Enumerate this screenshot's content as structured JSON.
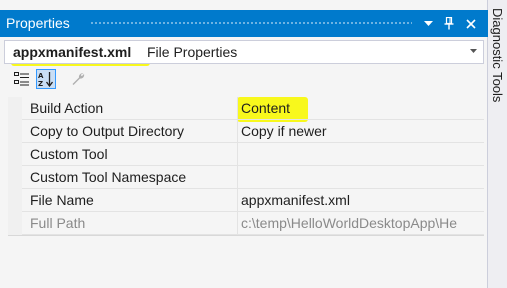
{
  "window": {
    "title": "Properties",
    "buttons": {
      "dropdown_icon": "chevron-down-icon",
      "pin_icon": "pin-icon",
      "close_icon": "close-icon"
    }
  },
  "object_selector": {
    "name": "appxmanifest.xml",
    "type": "File Properties"
  },
  "toolbar": {
    "categorized_icon": "categorized-icon",
    "alphabetical_icon": "alphabetical-icon",
    "property_pages_icon": "wrench-icon"
  },
  "properties": [
    {
      "name": "Build Action",
      "value": "Content"
    },
    {
      "name": "Copy to Output Directory",
      "value": "Copy if newer"
    },
    {
      "name": "Custom Tool",
      "value": ""
    },
    {
      "name": "Custom Tool Namespace",
      "value": ""
    },
    {
      "name": "File Name",
      "value": "appxmanifest.xml"
    },
    {
      "name": "Full Path",
      "value": "c:\\temp\\HelloWorldDesktopApp\\He"
    }
  ],
  "side_tab": {
    "label": "Diagnostic Tools"
  },
  "colors": {
    "accent": "#007acc",
    "highlight": "#f8f81c"
  }
}
